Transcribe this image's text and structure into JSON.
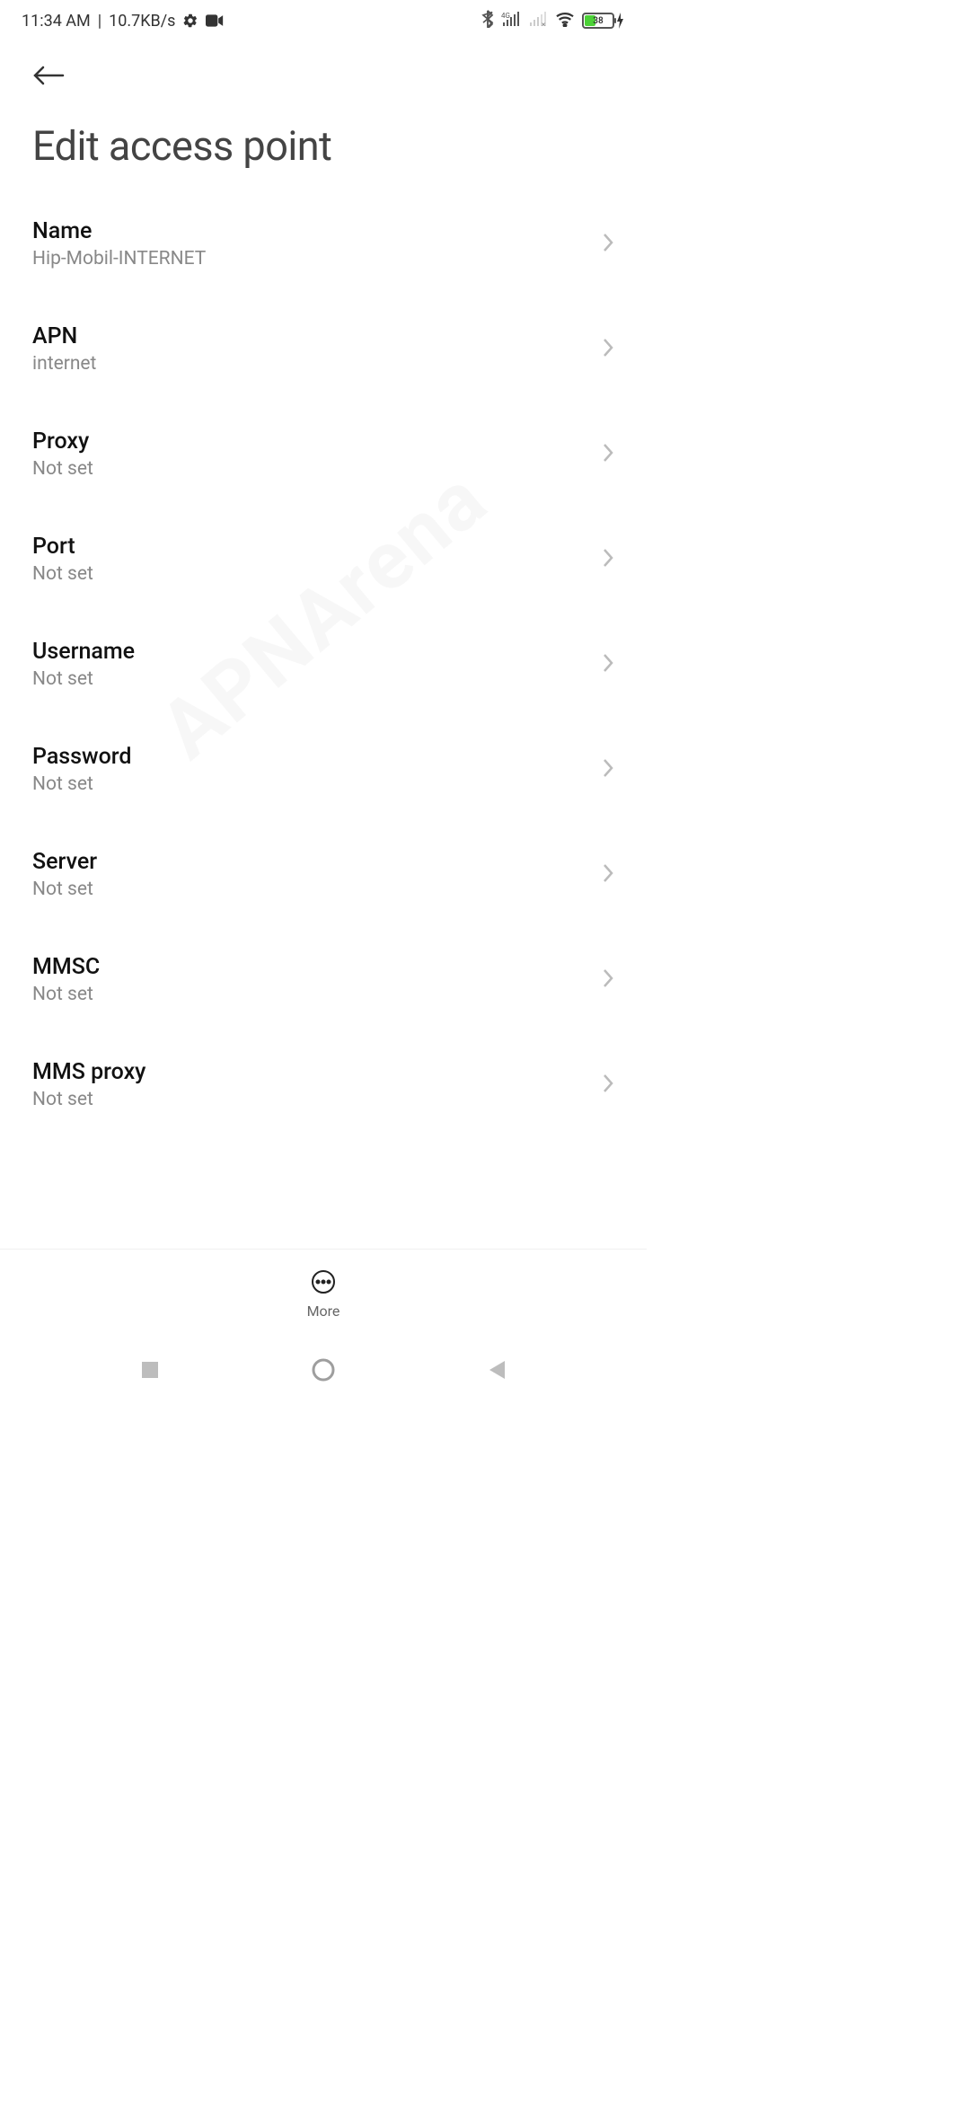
{
  "statusbar": {
    "time": "11:34 AM",
    "divider": "|",
    "netspeed": "10.7KB/s",
    "battery_percent": "38"
  },
  "header": {
    "title": "Edit access point"
  },
  "settings": [
    {
      "label": "Name",
      "value": "Hip-Mobil-INTERNET"
    },
    {
      "label": "APN",
      "value": "internet"
    },
    {
      "label": "Proxy",
      "value": "Not set"
    },
    {
      "label": "Port",
      "value": "Not set"
    },
    {
      "label": "Username",
      "value": "Not set"
    },
    {
      "label": "Password",
      "value": "Not set"
    },
    {
      "label": "Server",
      "value": "Not set"
    },
    {
      "label": "MMSC",
      "value": "Not set"
    },
    {
      "label": "MMS proxy",
      "value": "Not set"
    }
  ],
  "bottombar": {
    "more_label": "More"
  },
  "watermark": "APNArena"
}
